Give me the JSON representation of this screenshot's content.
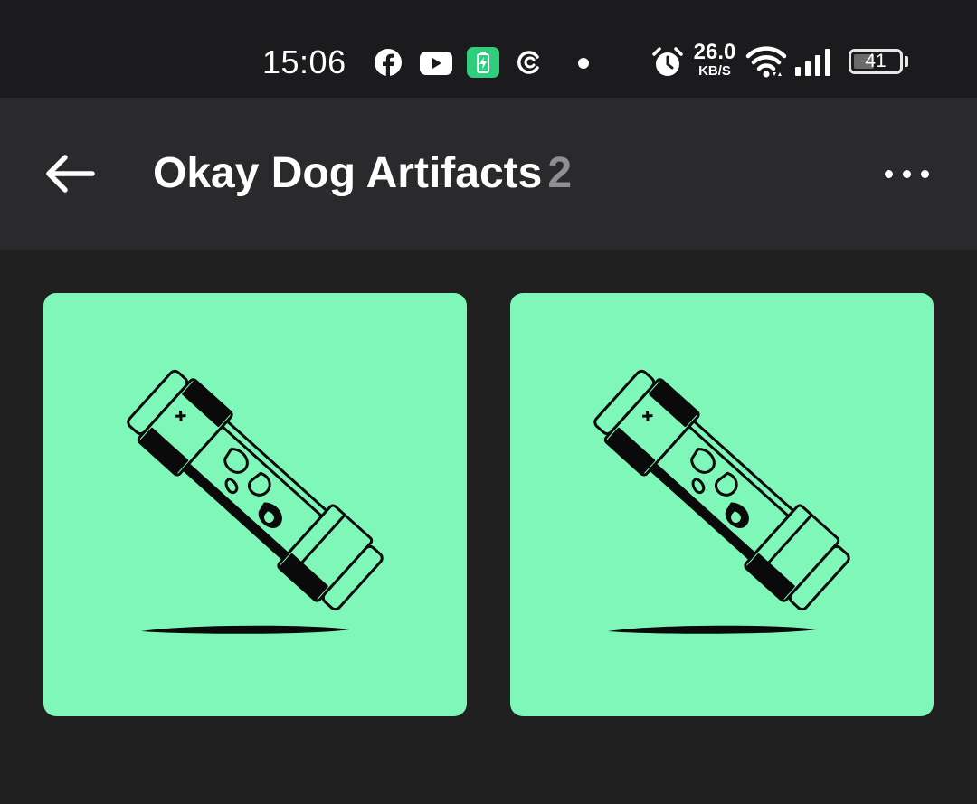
{
  "status_bar": {
    "time": "15:06",
    "icons": [
      "facebook-icon",
      "youtube-icon",
      "battery-app-icon",
      "circle-app-icon",
      "notification-dot-icon",
      "alarm-icon",
      "wifi-icon",
      "signal-icon"
    ],
    "net_speed_value": "26.0",
    "net_speed_unit": "KB/S",
    "battery_level": "41"
  },
  "app_bar": {
    "back_icon": "arrow-left-icon",
    "title": "Okay Dog Artifacts",
    "count": "2",
    "more_icon": "more-horizontal-icon"
  },
  "grid": {
    "items": [
      {
        "image": "artifact-capsule-illustration",
        "background": "#7ff7b9"
      },
      {
        "image": "artifact-capsule-illustration",
        "background": "#7ff7b9"
      }
    ]
  },
  "colors": {
    "background": "#202020",
    "status_bar": "#1b1b1d",
    "app_bar": "#2a2a2d",
    "card": "#7ff7b9",
    "count_text": "#8f8f91"
  }
}
